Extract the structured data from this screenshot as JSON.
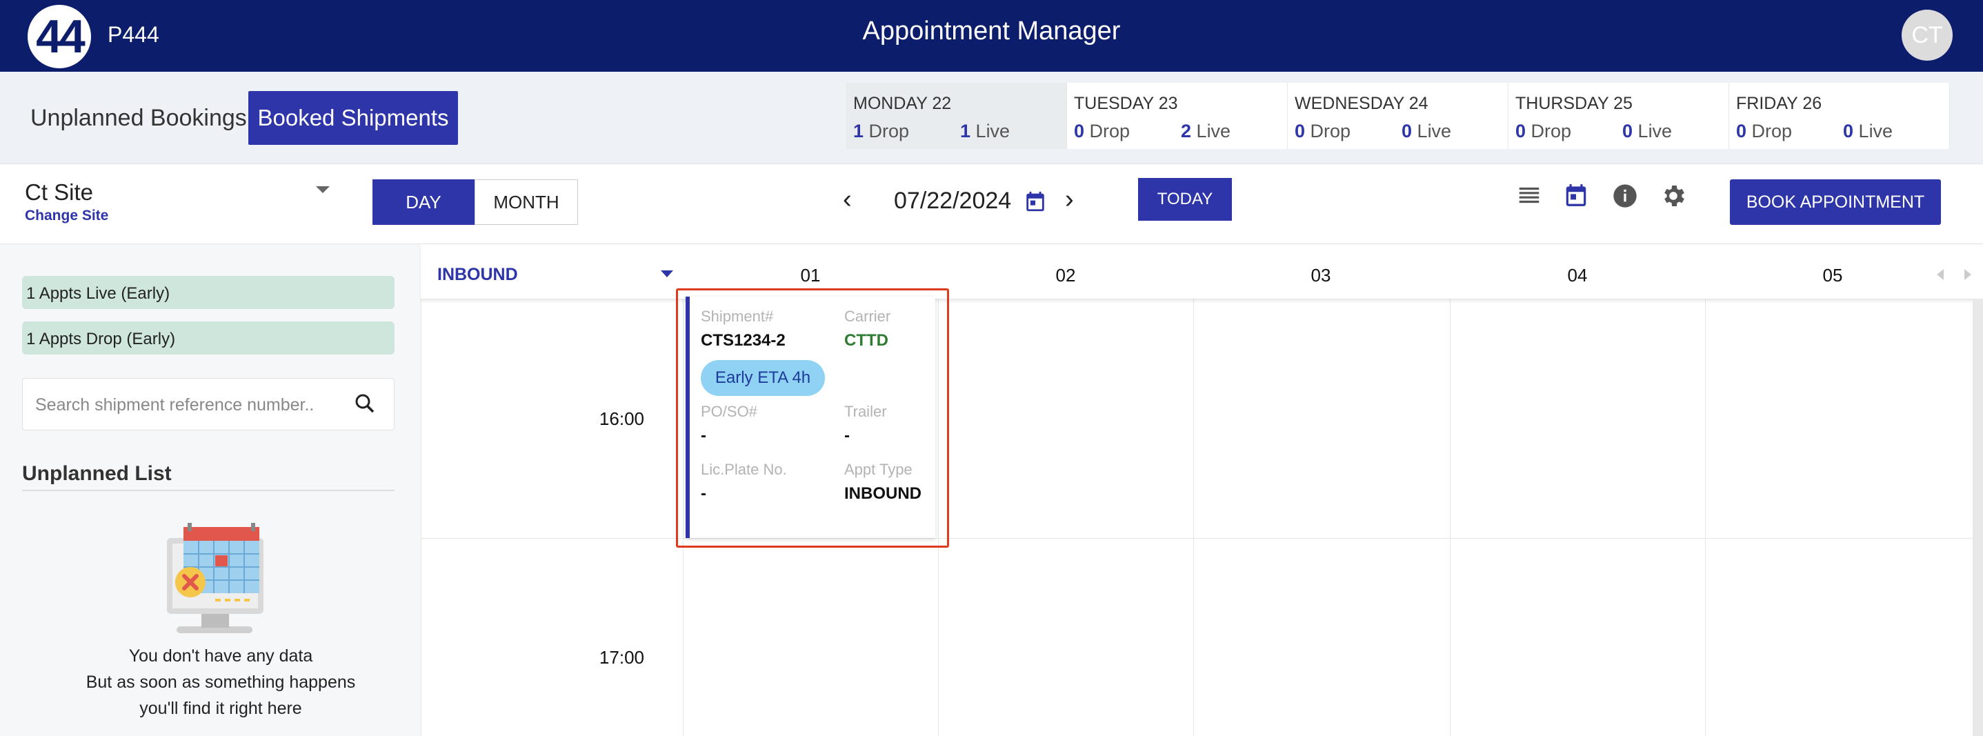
{
  "header": {
    "logo_text": "44",
    "org": "P444",
    "title": "Appointment Manager",
    "avatar": "CT"
  },
  "subnav": {
    "unplanned": "Unplanned Bookings",
    "booked": "Booked Shipments"
  },
  "days": [
    {
      "name": "MONDAY 22",
      "drop": "1",
      "live": "1"
    },
    {
      "name": "TUESDAY 23",
      "drop": "0",
      "live": "2"
    },
    {
      "name": "WEDNESDAY 24",
      "drop": "0",
      "live": "0"
    },
    {
      "name": "THURSDAY 25",
      "drop": "0",
      "live": "0"
    },
    {
      "name": "FRIDAY 26",
      "drop": "0",
      "live": "0"
    }
  ],
  "labels": {
    "drop": "Drop",
    "live": "Live"
  },
  "toolbar": {
    "site": "Ct Site",
    "change_site": "Change Site",
    "day": "DAY",
    "month": "MONTH",
    "date": "07/22/2024",
    "today": "TODAY",
    "book": "BOOK APPOINTMENT",
    "icons": [
      "list-icon",
      "calendar-icon",
      "info-icon",
      "gear-icon"
    ]
  },
  "sidebar": {
    "pill_live": "1 Appts Live (Early)",
    "pill_drop": "1 Appts Drop (Early)",
    "search_placeholder": "Search shipment reference number..",
    "unplanned_title": "Unplanned List",
    "empty_line1": "You don't have any data",
    "empty_line2": "But as soon as something happens",
    "empty_line3": "you'll find it right here"
  },
  "calendar": {
    "filter": "INBOUND",
    "columns": [
      "01",
      "02",
      "03",
      "04",
      "05"
    ],
    "times": [
      "16:00",
      "17:00"
    ]
  },
  "card": {
    "shipment_label": "Shipment#",
    "shipment": "CTS1234-2",
    "carrier_label": "Carrier",
    "carrier": "CTTD",
    "eta": "Early ETA 4h",
    "po_label": "PO/SO#",
    "po": "-",
    "trailer_label": "Trailer",
    "trailer": "-",
    "plate_label": "Lic.Plate No.",
    "plate": "-",
    "type_label": "Appt Type",
    "type": "INBOUND"
  },
  "colors": {
    "primary": "#2e35a8",
    "header": "#0b1d6b",
    "highlight": "#e03a1e"
  }
}
